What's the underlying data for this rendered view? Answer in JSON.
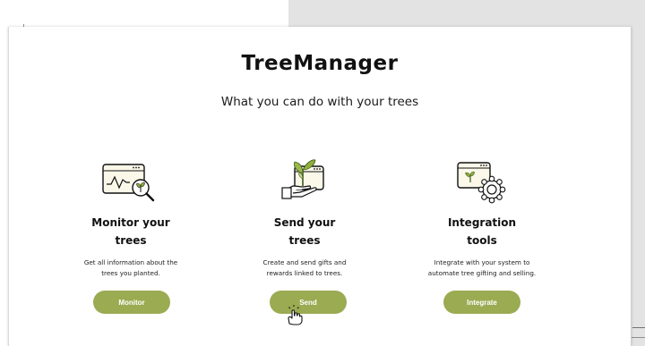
{
  "app": {
    "title": "TreeManager",
    "subtitle": "What you can do with your trees"
  },
  "features": [
    {
      "title_line1": "Monitor your",
      "title_line2": "trees",
      "desc_line1": "Get all information about the",
      "desc_line2": "trees you planted.",
      "button": "Monitor",
      "icon": "monitor-icon"
    },
    {
      "title_line1": "Send your",
      "title_line2": "trees",
      "desc_line1": "Create and send gifts and",
      "desc_line2": "rewards linked to trees.",
      "button": "Send",
      "icon": "send-gift-icon"
    },
    {
      "title_line1": "Integration",
      "title_line2": "tools",
      "desc_line1": "Integrate with your system to",
      "desc_line2": "automate tree gifting and selling.",
      "button": "Integrate",
      "icon": "integration-gear-icon"
    }
  ],
  "colors": {
    "accent": "#9aab52",
    "leaf": "#8fae3c",
    "window_fill": "#fbf8ea"
  },
  "cursor": {
    "icon": "hand-pointer-icon"
  }
}
